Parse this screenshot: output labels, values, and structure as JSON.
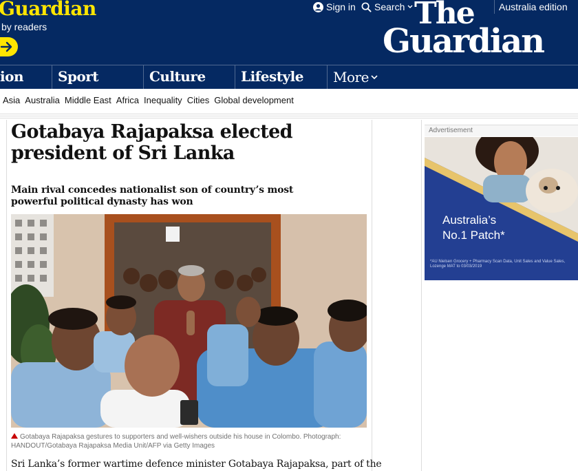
{
  "header": {
    "support_title": "Guardian",
    "support_sub": "by readers",
    "sign_in": "Sign in",
    "search": "Search",
    "edition": "Australia edition",
    "logo_line1": "The",
    "logo_line2": "Guardian",
    "icons": {
      "support_arrow": "arrow-right-icon",
      "sign_in": "user-icon",
      "search": "search-icon",
      "dropdown": "chevron-down-icon"
    },
    "colors": {
      "brand": "#052962",
      "accent": "#ffe500"
    }
  },
  "pillars": [
    {
      "label": "ion"
    },
    {
      "label": "Sport"
    },
    {
      "label": "Culture"
    },
    {
      "label": "Lifestyle"
    },
    {
      "label": "More"
    }
  ],
  "subnav": [
    "Asia",
    "Australia",
    "Middle East",
    "Africa",
    "Inequality",
    "Cities",
    "Global development"
  ],
  "article": {
    "headline": "Gotabaya Rajapaksa elected president of Sri Lanka",
    "standfirst": "Main rival concedes nationalist son of country’s most powerful political dynasty has won",
    "caption": "Gotabaya Rajapaksa gestures to supporters and well-wishers outside his house in Colombo. Photograph: HANDOUT/Gotabaya Rajapaksa Media Unit/AFP via Getty Images",
    "body_first_line": "Sri Lanka’s former wartime defence minister Gotabaya Rajapaksa, part of the"
  },
  "ad": {
    "label": "Advertisement",
    "headline_line1": "Australia’s",
    "headline_line2": "No.1 Patch*",
    "fine_print": "*AU Nielsen Grocery + Pharmacy Scan Data, Unit Sales and Value Sales, Lozenge MAT to 03/03/2019"
  }
}
